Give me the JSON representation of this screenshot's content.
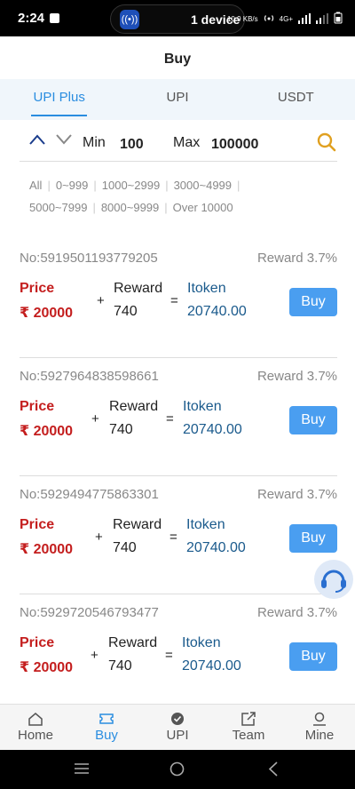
{
  "status_bar": {
    "time": "2:24",
    "pill_text": "1 device",
    "net_speed": "10.9 KB/s",
    "network": "4G+"
  },
  "header": {
    "title": "Buy"
  },
  "tabs": [
    {
      "label": "UPI Plus",
      "active": true
    },
    {
      "label": "UPI",
      "active": false
    },
    {
      "label": "USDT",
      "active": false
    }
  ],
  "filter": {
    "min_label": "Min",
    "min_value": "100",
    "max_label": "Max",
    "max_value": "100000"
  },
  "ranges": [
    "All",
    "0~999",
    "1000~2999",
    "3000~4999",
    "5000~7999",
    "8000~9999",
    "Over 10000"
  ],
  "orders": [
    {
      "no": "No:5919501193779205",
      "reward_pct": "Reward 3.7%",
      "price_label": "Price",
      "price": "₹ 20000",
      "plus": "+",
      "reward_label": "Reward",
      "reward": "740",
      "eq": "=",
      "token_label": "Itoken",
      "token": "20740.00",
      "buy": "Buy"
    },
    {
      "no": "No:5927964838598661",
      "reward_pct": "Reward 3.7%",
      "price_label": "Price",
      "price": "₹ 20000",
      "plus": "+",
      "reward_label": "Reward",
      "reward": "740",
      "eq": "=",
      "token_label": "Itoken",
      "token": "20740.00",
      "buy": "Buy"
    },
    {
      "no": "No:5929494775863301",
      "reward_pct": "Reward 3.7%",
      "price_label": "Price",
      "price": "₹ 20000",
      "plus": "+",
      "reward_label": "Reward",
      "reward": "740",
      "eq": "=",
      "token_label": "Itoken",
      "token": "20740.00",
      "buy": "Buy"
    },
    {
      "no": "No:5929720546793477",
      "reward_pct": "Reward 3.7%",
      "price_label": "Price",
      "price": "₹ 20000",
      "plus": "+",
      "reward_label": "Reward",
      "reward": "740",
      "eq": "=",
      "token_label": "Itoken",
      "token": "20740.00",
      "buy": "Buy"
    }
  ],
  "bottom_nav": [
    {
      "label": "Home",
      "icon": "home-icon",
      "active": false
    },
    {
      "label": "Buy",
      "icon": "ticket-icon",
      "active": true
    },
    {
      "label": "UPI",
      "icon": "check-circle-icon",
      "active": false
    },
    {
      "label": "Team",
      "icon": "share-icon",
      "active": false
    },
    {
      "label": "Mine",
      "icon": "user-icon",
      "active": false
    }
  ],
  "colors": {
    "accent": "#2a8de0",
    "price_red": "#c41e1e",
    "token_blue": "#1a5a8c",
    "buy_button": "#4a9ef0",
    "search_icon": "#e0a020"
  }
}
